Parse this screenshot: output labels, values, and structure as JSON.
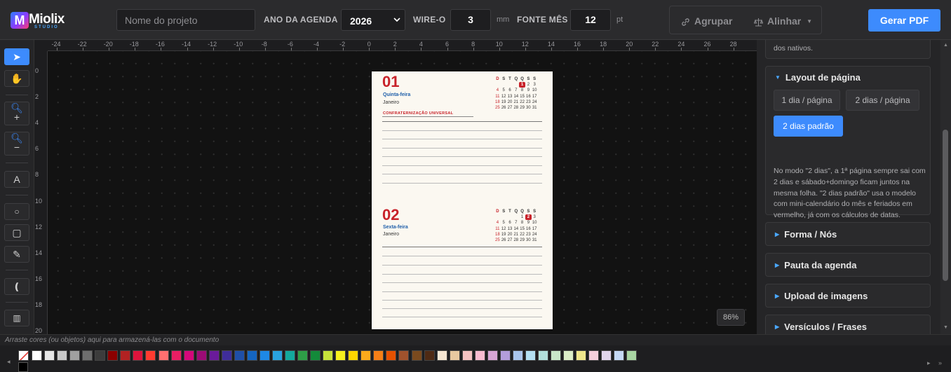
{
  "app": {
    "logo_text": "Miolix",
    "logo_sub": "STUDIO"
  },
  "header": {
    "project_placeholder": "Nome do projeto",
    "year_label": "ANO DA AGENDA",
    "year_value": "2026",
    "wireo_label": "WIRE-O",
    "wireo_value": "3",
    "wireo_unit": "mm",
    "font_label": "FONTE MÊS",
    "font_value": "12",
    "font_unit": "pt",
    "group_label": "Agrupar",
    "align_label": "Alinhar",
    "pdf_label": "Gerar PDF"
  },
  "tools": [
    {
      "name": "select-tool",
      "glyph": "➤",
      "active": true
    },
    {
      "name": "hand-tool",
      "glyph": "✋",
      "active": false
    },
    {
      "name": "zoom-in-tool",
      "glyph": "+",
      "active": false
    },
    {
      "name": "zoom-out-tool",
      "glyph": "−",
      "active": false
    },
    {
      "name": "text-tool",
      "glyph": "A",
      "active": false
    },
    {
      "name": "circle-tool",
      "glyph": "○",
      "active": false
    },
    {
      "name": "rect-tool",
      "glyph": "▢",
      "active": false
    },
    {
      "name": "pen-tool",
      "glyph": "✎",
      "active": false
    },
    {
      "name": "curve-tool",
      "glyph": "(",
      "active": false
    },
    {
      "name": "trash-tool",
      "glyph": "🗑",
      "active": false
    }
  ],
  "ruler": {
    "h_ticks": [
      "-24",
      "-22",
      "-20",
      "-18",
      "-16",
      "-14",
      "-12",
      "-10",
      "-8",
      "-6",
      "-4",
      "-2",
      "0",
      "2",
      "4",
      "6",
      "8",
      "10",
      "12",
      "14",
      "16",
      "18",
      "20",
      "22",
      "24",
      "26",
      "28"
    ],
    "v_ticks": [
      "0",
      "2",
      "4",
      "6",
      "8",
      "10",
      "12",
      "14",
      "16",
      "18",
      "20"
    ]
  },
  "page": {
    "days": [
      {
        "num": "01",
        "weekday": "Quinta-feira",
        "month": "Janeiro",
        "holiday": "CONFRATERNIZAÇÃO UNIVERSAL",
        "highlight": "1"
      },
      {
        "num": "02",
        "weekday": "Sexta-feira",
        "month": "Janeiro",
        "holiday": "",
        "highlight": "2"
      }
    ],
    "calendar_header": [
      "D",
      "S",
      "T",
      "Q",
      "Q",
      "S",
      "S"
    ],
    "calendar_weeks": [
      [
        "",
        "",
        "",
        "",
        "1",
        "2",
        "3"
      ],
      [
        "4",
        "5",
        "6",
        "7",
        "8",
        "9",
        "10"
      ],
      [
        "11",
        "12",
        "13",
        "14",
        "15",
        "16",
        "17"
      ],
      [
        "18",
        "19",
        "20",
        "21",
        "22",
        "23",
        "24"
      ],
      [
        "25",
        "26",
        "27",
        "28",
        "29",
        "30",
        "31"
      ]
    ]
  },
  "zoom": "86%",
  "sidebar": {
    "top_text": "dos nativos.",
    "layout_title": "Layout de página",
    "options": [
      "1 dia / página",
      "2 dias / página",
      "2 dias padrão"
    ],
    "selected_option": "2 dias padrão",
    "description": "No modo \"2 dias\", a 1ª página sempre sai com 2 dias e sábado+domingo ficam juntos na mesma folha. \"2 dias padrão\" usa o modelo com mini-calendário do mês e feriados em vermelho, já com os cálculos de datas.",
    "sections": [
      "Forma / Nós",
      "Pauta da agenda",
      "Upload de imagens",
      "Versículos / Frases"
    ]
  },
  "bottom": {
    "hint": "Arraste cores (ou objetos) aqui para armazená-las com o documento",
    "swatches": [
      "#ffffff",
      "#e6e6e6",
      "#c8c8c8",
      "#a0a0a0",
      "#6e6e6e",
      "#3c3c3c",
      "#8b0000",
      "#b22222",
      "#dc143c",
      "#ff3b30",
      "#ff7070",
      "#e91e63",
      "#d4087a",
      "#9c0c75",
      "#6a1b9a",
      "#3f2d9a",
      "#1f4fa8",
      "#1565c0",
      "#1e88e5",
      "#29a3e0",
      "#14a99d",
      "#2e9e47",
      "#138a3a",
      "#c6e03a",
      "#f6f01e",
      "#ffd600",
      "#fbaa1c",
      "#f57f17",
      "#e65100",
      "#a0522d",
      "#7a4a1e",
      "#4e2a14",
      "#f5e6d3",
      "#e8c9a0",
      "#f4c2c2",
      "#f8bbd0",
      "#d7a6d4",
      "#b39ddb",
      "#a9c5ea",
      "#b3e0f2",
      "#b2dfdb",
      "#c8e6c9",
      "#dcedc8",
      "#f0e68c",
      "#f5d0dc",
      "#e1d5ec",
      "#c5d9f5",
      "#a8d5a2"
    ]
  }
}
